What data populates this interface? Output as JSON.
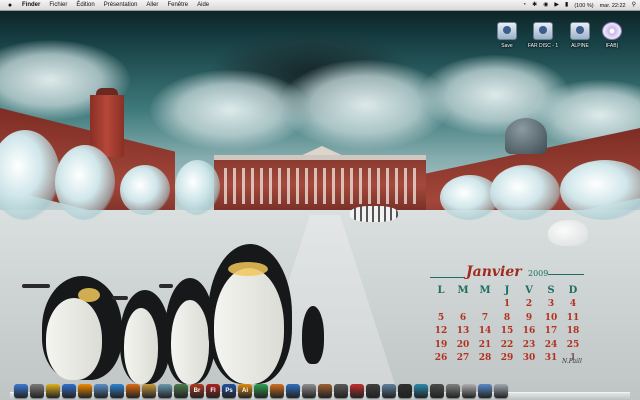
{
  "menubar": {
    "apple": "",
    "items": [
      "Finder",
      "Fichier",
      "Édition",
      "Présentation",
      "Aller",
      "Fenêtre",
      "Aide"
    ],
    "battery": "(100 %)",
    "clock": "mar. 22:22"
  },
  "desktop_icons": [
    {
      "label": "Save",
      "icon": "drive-icon"
    },
    {
      "label": "FAR DISC - 1",
      "icon": "drive-icon"
    },
    {
      "label": "ALPINE",
      "icon": "drive-icon"
    },
    {
      "label": "IFAB)",
      "icon": "cd-icon"
    }
  ],
  "calendar": {
    "month": "Janvier",
    "year": "2009",
    "weekdays": [
      "L",
      "M",
      "M",
      "J",
      "V",
      "S",
      "D"
    ],
    "weeks": [
      [
        "",
        "",
        "",
        "1",
        "2",
        "3",
        "4"
      ],
      [
        "5",
        "6",
        "7",
        "8",
        "9",
        "10",
        "11"
      ],
      [
        "12",
        "13",
        "14",
        "15",
        "16",
        "17",
        "18"
      ],
      [
        "19",
        "20",
        "21",
        "22",
        "23",
        "24",
        "25"
      ],
      [
        "26",
        "27",
        "28",
        "29",
        "30",
        "31",
        "1"
      ]
    ],
    "credit": "N.Faill"
  },
  "dock": {
    "apps": [
      {
        "name": "finder-icon",
        "color": "#3a7bd5",
        "glyph": ""
      },
      {
        "name": "system-preferences-icon",
        "color": "#7a7a7a",
        "glyph": ""
      },
      {
        "name": "ichat-icon",
        "color": "#e0b020",
        "glyph": ""
      },
      {
        "name": "itunes-icon",
        "color": "#2f6fcf",
        "glyph": ""
      },
      {
        "name": "vlc-icon",
        "color": "#f08a00",
        "glyph": ""
      },
      {
        "name": "mail-icon",
        "color": "#5a8fc8",
        "glyph": ""
      },
      {
        "name": "safari-icon",
        "color": "#2d82d0",
        "glyph": ""
      },
      {
        "name": "firefox-icon",
        "color": "#e06a10",
        "glyph": ""
      },
      {
        "name": "photo-icon",
        "color": "#c89a40",
        "glyph": ""
      },
      {
        "name": "preview-icon",
        "color": "#6a9ab0",
        "glyph": ""
      },
      {
        "name": "app-icon",
        "color": "#4a7a4a",
        "glyph": ""
      },
      {
        "name": "bridge-icon",
        "color": "#b03a1a",
        "glyph": "Br"
      },
      {
        "name": "flash-icon",
        "color": "#b02020",
        "glyph": "Fl"
      },
      {
        "name": "photoshop-icon",
        "color": "#2050a0",
        "glyph": "Ps"
      },
      {
        "name": "illustrator-icon",
        "color": "#e08a10",
        "glyph": "Ai"
      },
      {
        "name": "dreamweaver-icon",
        "color": "#30a050",
        "glyph": ""
      },
      {
        "name": "app-icon",
        "color": "#d07020",
        "glyph": ""
      },
      {
        "name": "app-icon",
        "color": "#3070c0",
        "glyph": ""
      },
      {
        "name": "app-icon",
        "color": "#909090",
        "glyph": ""
      },
      {
        "name": "app-icon",
        "color": "#a06030",
        "glyph": ""
      },
      {
        "name": "app-icon",
        "color": "#5a5a5a",
        "glyph": ""
      },
      {
        "name": "app-icon",
        "color": "#c03030",
        "glyph": ""
      },
      {
        "name": "app-icon",
        "color": "#404040",
        "glyph": ""
      },
      {
        "name": "app-icon",
        "color": "#6080a0",
        "glyph": ""
      },
      {
        "name": "app-icon",
        "color": "#303030",
        "glyph": ""
      },
      {
        "name": "app-icon",
        "color": "#2a8ab0",
        "glyph": ""
      },
      {
        "name": "app-icon",
        "color": "#4a4a4a",
        "glyph": ""
      },
      {
        "name": "app-icon",
        "color": "#808080",
        "glyph": ""
      },
      {
        "name": "app-icon",
        "color": "#b0b0b0",
        "glyph": ""
      },
      {
        "name": "folder-icon",
        "color": "#5a8ac8",
        "glyph": ""
      },
      {
        "name": "trash-icon",
        "color": "#a0a8b0",
        "glyph": ""
      }
    ]
  },
  "colors": {
    "menubar": "#e6e6e6",
    "calendar_red": "#b3321f",
    "calendar_green": "#1f6e60"
  }
}
